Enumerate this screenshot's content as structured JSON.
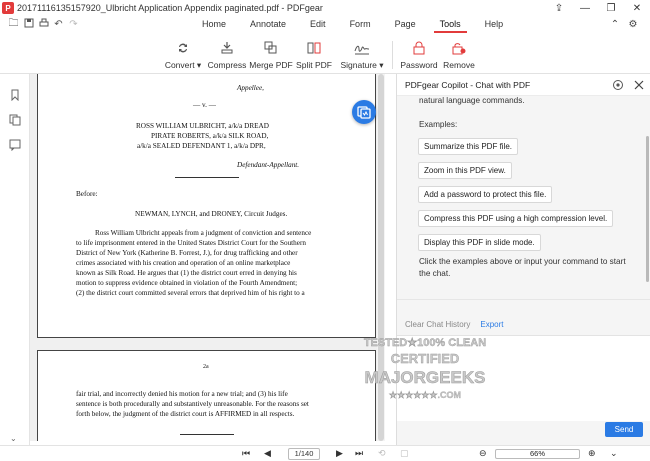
{
  "window": {
    "title": "20171116135157920_Ulbricht Application Appendix paginated.pdf - PDFgear",
    "logo": "P"
  },
  "menu": {
    "tabs": [
      "Home",
      "Annotate",
      "Edit",
      "Form",
      "Page",
      "Tools",
      "Help"
    ],
    "active": "Tools"
  },
  "toolbar": {
    "tools": [
      {
        "label": "Convert ▾",
        "icon": "convert-icon"
      },
      {
        "label": "Compress",
        "icon": "compress-icon"
      },
      {
        "label": "Merge PDF",
        "icon": "merge-icon"
      },
      {
        "label": "Split PDF",
        "icon": "split-icon"
      },
      {
        "label": "Signature ▾",
        "icon": "signature-icon"
      },
      {
        "label": "Password",
        "icon": "lock-icon"
      },
      {
        "label": "Remove",
        "icon": "remove-lock-icon"
      }
    ]
  },
  "document": {
    "page1": [
      "Appellee,",
      "— v. —",
      "ROSS WILLIAM ULBRICHT, a/k/a DREAD",
      "PIRATE ROBERTS, a/k/a SILK ROAD,",
      "a/k/a SEALED DEFENDANT 1, a/k/a DPR,",
      "Defendant-Appellant.",
      "Before:",
      "NEWMAN, LYNCH, and DRONEY, Circuit Judges.",
      "Ross William Ulbricht appeals from a judgment of conviction and sentence",
      "to life imprisonment entered in the United States District Court for the Southern",
      "District of New York (Katherine B. Forrest, J.), for drug trafficking and other",
      "crimes associated with his creation and operation of an online marketplace",
      "known as Silk Road. He argues that (1) the district court erred in denying his",
      "motion to suppress evidence obtained in violation of the Fourth Amendment;",
      "(2) the district court committed several errors that deprived him of his right to a"
    ],
    "page2": [
      "2a",
      "fair trial, and incorrectly denied his motion for a new trial; and (3) his life",
      "sentence is both procedurally and substantively unreasonable. For the reasons set",
      "forth below, the judgment of the district court is AFFIRMED in all respects."
    ]
  },
  "copilot": {
    "title": "PDFgear Copilot - Chat with PDF",
    "intro_cut": "natural language commands.",
    "examples_label": "Examples:",
    "examples": [
      "Summarize this PDF file.",
      "Zoom in this PDF view.",
      "Add a password to protect this file.",
      "Compress this PDF using a high compression level.",
      "Display this PDF in slide mode."
    ],
    "instructions": "Click the examples above or input your command to start the chat.",
    "clear": "Clear Chat History",
    "export": "Export",
    "send": "Send"
  },
  "watermark": {
    "line1": "TESTED★100% CLEAN",
    "line2": "CERTIFIED",
    "line3": "MAJORGEEKS",
    "line4": "★★★★★★.COM"
  },
  "status": {
    "page_display": "1/140",
    "zoom": "66%"
  }
}
